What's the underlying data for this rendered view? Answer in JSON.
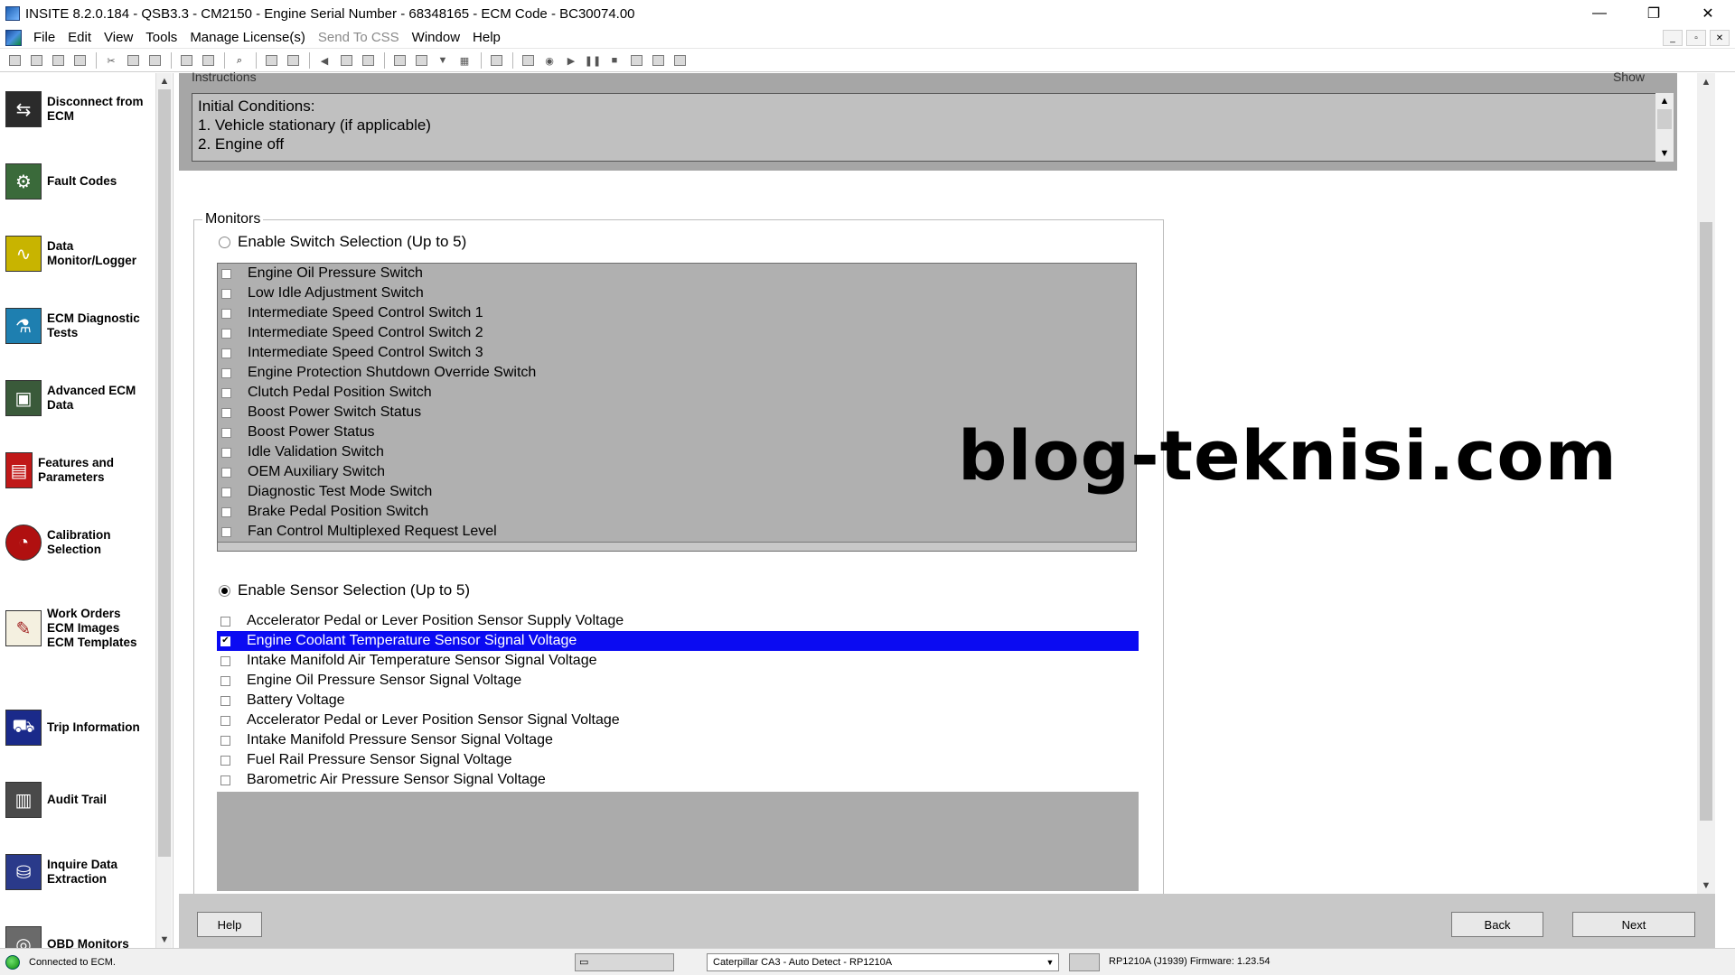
{
  "window": {
    "title": "INSITE 8.2.0.184  - QSB3.3 - CM2150 - Engine Serial Number - 68348165 - ECM Code - BC30074.00",
    "minimize": "—",
    "restore": "❐",
    "close": "✕"
  },
  "menu": {
    "items": [
      "File",
      "Edit",
      "View",
      "Tools",
      "Manage License(s)",
      "Send To CSS",
      "Window",
      "Help"
    ]
  },
  "sidebar": {
    "items": [
      {
        "label": "Disconnect from\nECM",
        "icon": "disconnect-icon",
        "color": "#2b2b2b"
      },
      {
        "label": "Fault Codes",
        "icon": "fault-codes-icon",
        "color": "#3a6a3a"
      },
      {
        "label": "Data\nMonitor/Logger",
        "icon": "data-monitor-icon",
        "color": "#c8b400"
      },
      {
        "label": "ECM Diagnostic\nTests",
        "icon": "diagnostic-tests-icon",
        "color": "#1e7fb0"
      },
      {
        "label": "Advanced ECM\nData",
        "icon": "advanced-ecm-icon",
        "color": "#3a5a3a"
      },
      {
        "label": "Features and\nParameters",
        "icon": "features-parameters-icon",
        "color": "#c01818"
      },
      {
        "label": "Calibration\nSelection",
        "icon": "calibration-icon",
        "color": "#b01010"
      },
      {
        "label": "Work Orders\nECM Images\nECM Templates",
        "icon": "work-orders-icon",
        "color": "#8a6a3a"
      },
      {
        "label": "Trip Information",
        "icon": "trip-information-icon",
        "color": "#1a2a8a"
      },
      {
        "label": "Audit Trail",
        "icon": "audit-trail-icon",
        "color": "#4a4a4a"
      },
      {
        "label": "Inquire Data\nExtraction",
        "icon": "inquire-data-icon",
        "color": "#2a3a8a"
      },
      {
        "label": "OBD Monitors",
        "icon": "obd-monitors-icon",
        "color": "#6a6a6a"
      }
    ]
  },
  "instructions": {
    "legend": "Instructions",
    "show": "Show",
    "lines": [
      "Initial Conditions:",
      "1. Vehicle stationary (if applicable)",
      "2. Engine off"
    ]
  },
  "monitors": {
    "legend": "Monitors",
    "switch_radio": "Enable Switch Selection (Up to 5)",
    "sensor_radio": "Enable Sensor Selection (Up to 5)",
    "switches": [
      "Engine Oil Pressure Switch",
      "Low Idle Adjustment Switch",
      "Intermediate Speed Control Switch 1",
      "Intermediate Speed Control Switch 2",
      "Intermediate Speed Control Switch 3",
      "Engine Protection Shutdown Override Switch",
      "Clutch Pedal Position Switch",
      "Boost Power Switch Status",
      "Boost Power Status",
      "Idle Validation Switch",
      "OEM Auxiliary Switch",
      "Diagnostic Test Mode Switch",
      "Brake Pedal Position Switch",
      "Fan Control Multiplexed Request Level"
    ],
    "sensors": [
      {
        "label": "Accelerator Pedal or Lever Position Sensor Supply Voltage",
        "checked": false
      },
      {
        "label": "Engine Coolant Temperature Sensor Signal Voltage",
        "checked": true
      },
      {
        "label": "Intake Manifold Air Temperature Sensor Signal Voltage",
        "checked": false
      },
      {
        "label": "Engine Oil Pressure Sensor Signal Voltage",
        "checked": false
      },
      {
        "label": "Battery Voltage",
        "checked": false
      },
      {
        "label": "Accelerator Pedal or Lever Position Sensor Signal Voltage",
        "checked": false
      },
      {
        "label": "Intake Manifold Pressure Sensor Signal Voltage",
        "checked": false
      },
      {
        "label": "Fuel Rail Pressure Sensor Signal Voltage",
        "checked": false
      },
      {
        "label": "Barometric Air Pressure Sensor Signal Voltage",
        "checked": false
      }
    ]
  },
  "watermark": "blog-teknisi.com",
  "buttons": {
    "help": "Help",
    "back": "Back",
    "next": "Next"
  },
  "status": {
    "connection": "Connected to ECM.",
    "adapter": "Caterpillar CA3 - Auto Detect - RP1210A",
    "firmware": "RP1210A (J1939)  Firmware: 1.23.54"
  },
  "colors": {
    "selection": "#0b0bf2",
    "panel_gray": "#a6a6a6",
    "connected": "#0a8a0a"
  }
}
